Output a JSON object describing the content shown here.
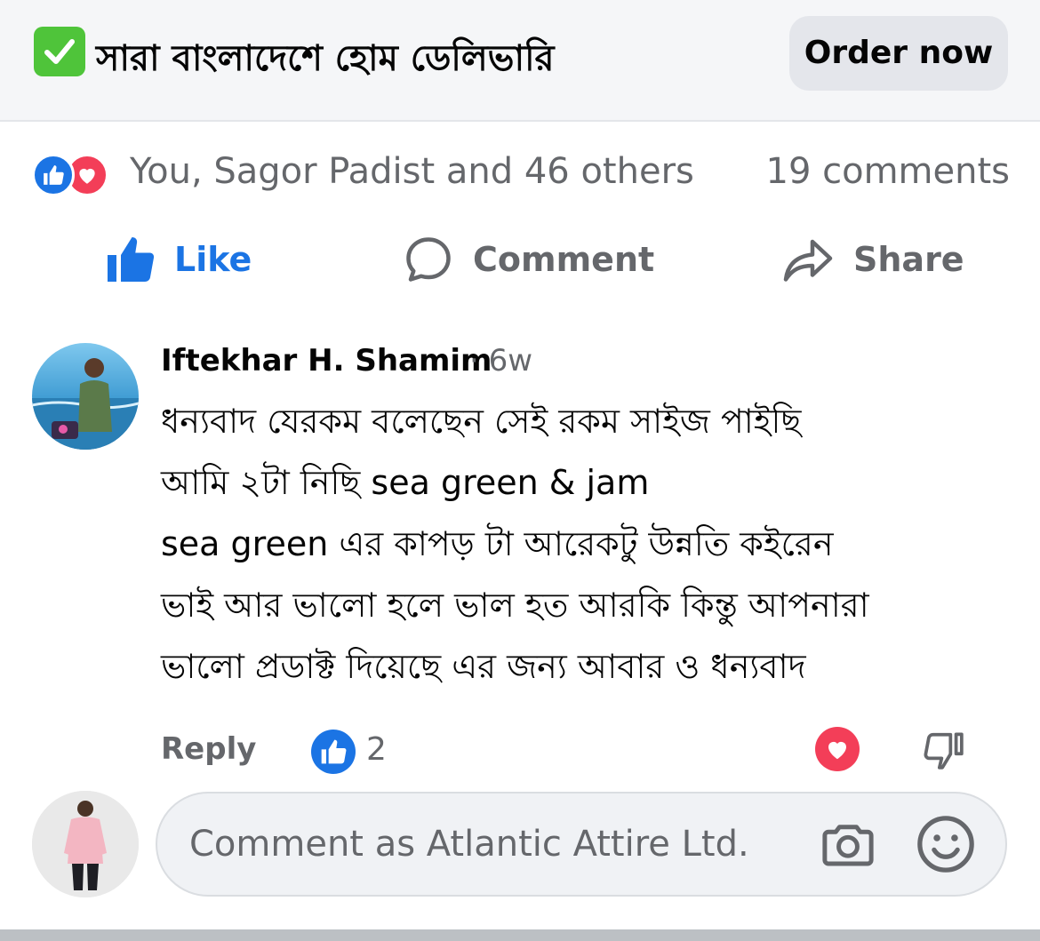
{
  "ad_banner": {
    "check_icon": "check-mark-button-emoji",
    "text": "সারা বাংলাদেশে হোম ডেলিভারি",
    "cta_label": "Order now"
  },
  "post_stats": {
    "reaction_icons": [
      "like-reaction-icon",
      "love-reaction-icon"
    ],
    "reactors_text": "You, Sagor Padist and 46 others",
    "comments_text": "19 comments"
  },
  "actions": {
    "like_label": "Like",
    "comment_label": "Comment",
    "share_label": "Share"
  },
  "comment": {
    "author": "Iftekhar H. Shamim",
    "time": "· 6w",
    "lines": [
      "ধন্যবাদ যেরকম বলেছেন সেই রকম সাইজ পাইছি",
      "আমি ২টা নিছি sea green & jam",
      "sea green এর কাপড় টা আরেকটু উন্নতি কইরেন",
      "ভাই আর ভালো হলে ভাল হত আরকি কিন্তু আপনারা",
      "ভালো প্রডাক্ট দিয়েছে এর জন্য আবার ও ধন্যবাদ"
    ],
    "reply_label": "Reply",
    "like_count": "2"
  },
  "composer": {
    "placeholder": "Comment as Atlantic Attire Ltd."
  },
  "colors": {
    "brand_blue": "#1b74e4",
    "love_red": "#f33e58",
    "secondary_text": "#65676b",
    "banner_bg": "#f5f6f8"
  }
}
